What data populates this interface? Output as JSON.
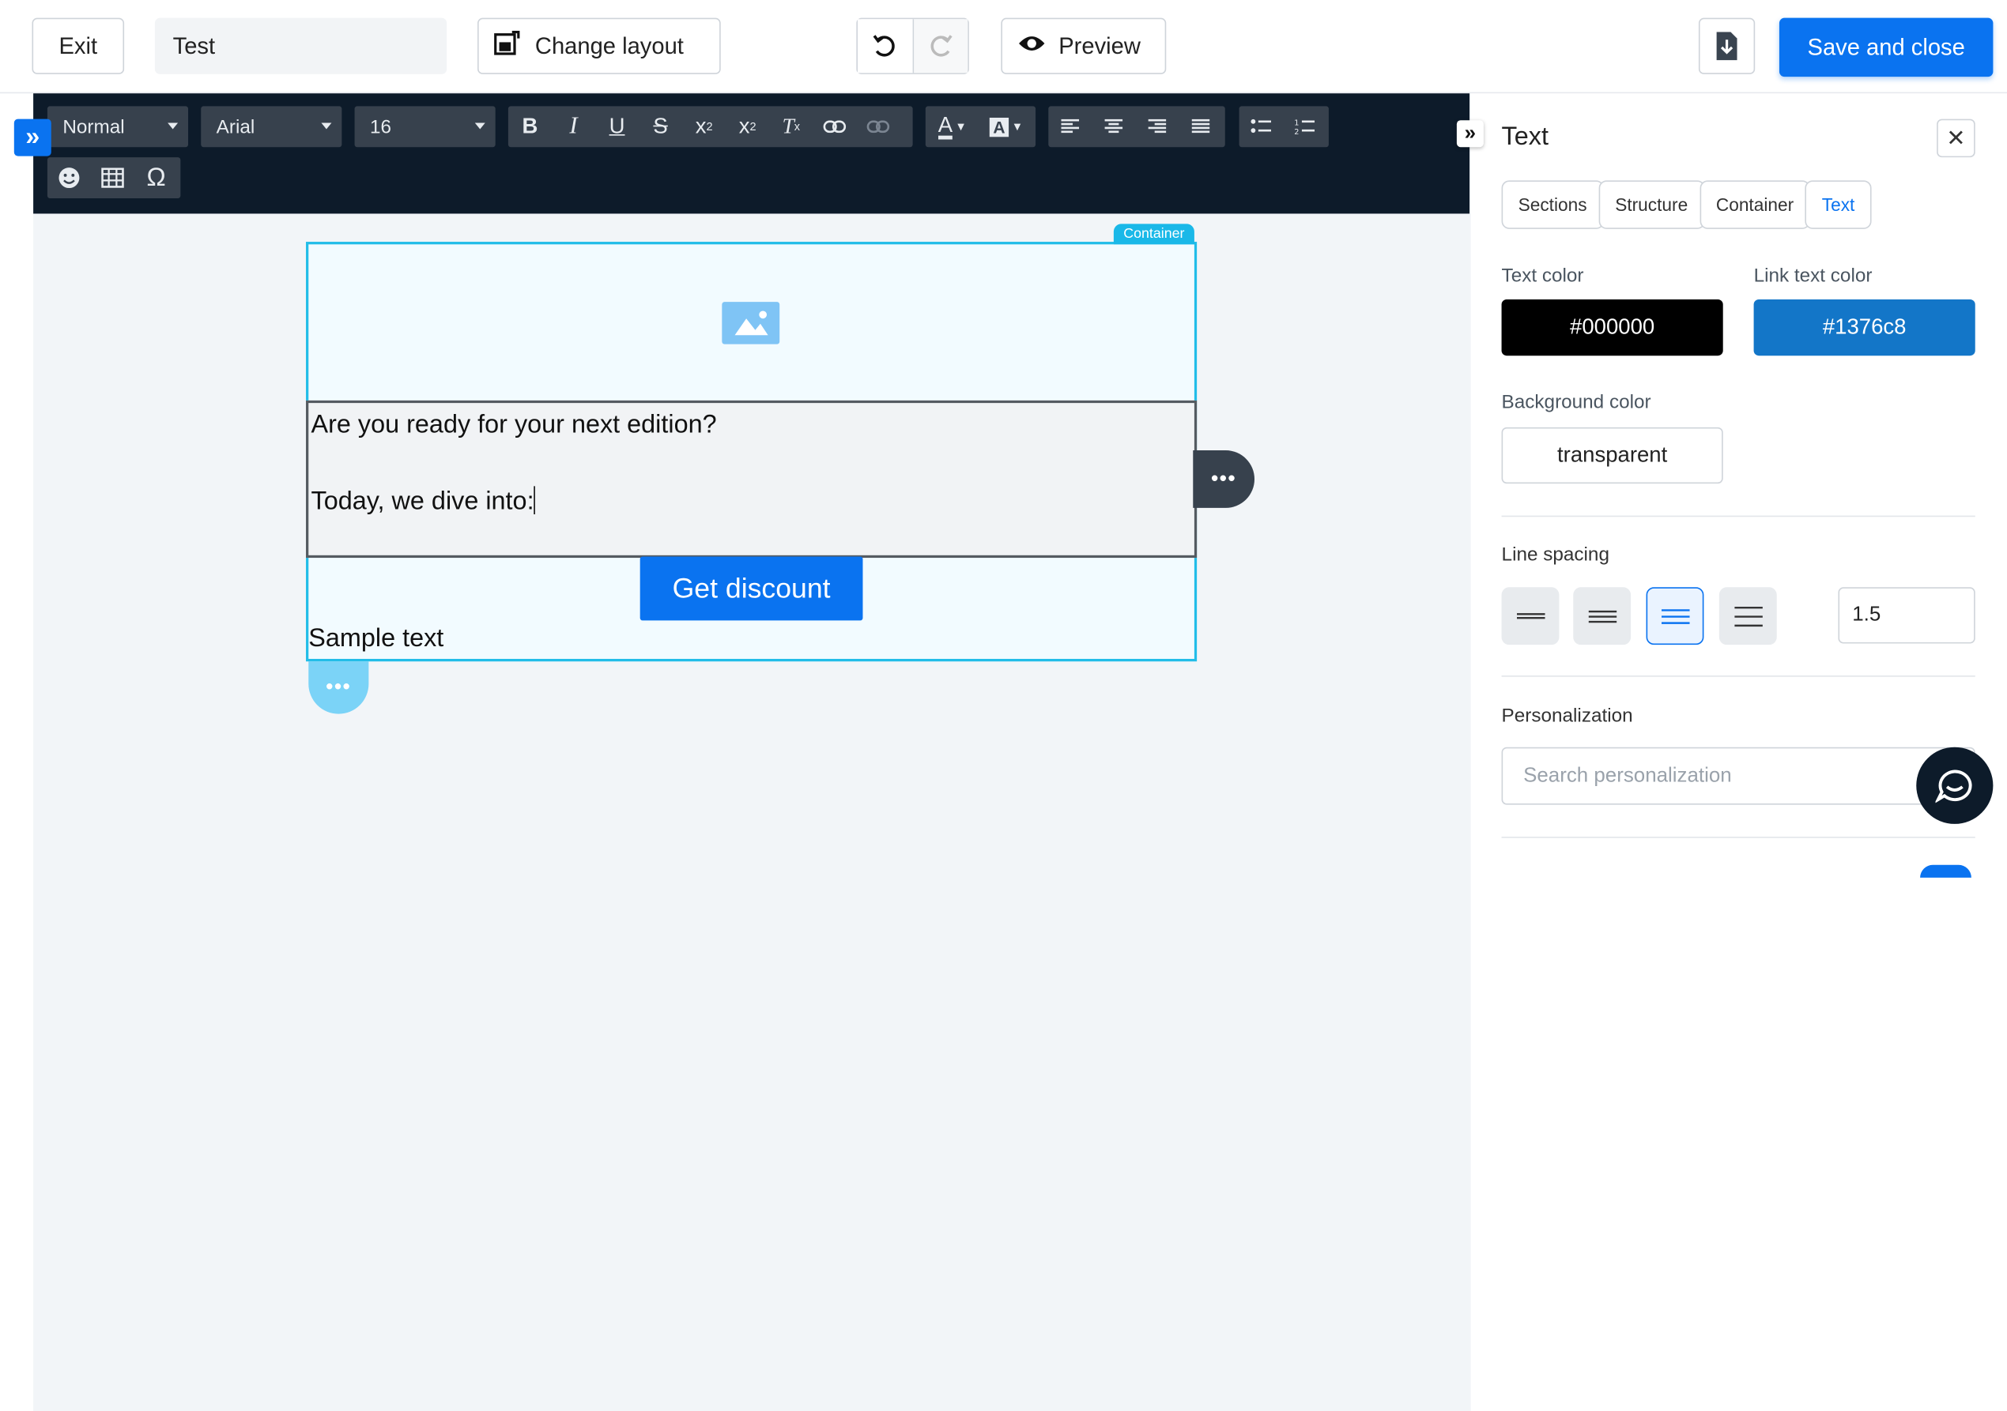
{
  "topbar": {
    "exit_label": "Exit",
    "title_value": "Test",
    "change_layout_label": "Change layout",
    "preview_label": "Preview",
    "save_label": "Save and close"
  },
  "toolbar": {
    "format_value": "Normal",
    "font_value": "Arial",
    "size_value": "16",
    "icons": [
      "bold-icon",
      "italic-icon",
      "underline-icon",
      "strikethrough-icon",
      "subscript-icon",
      "superscript-icon",
      "clear-format-icon",
      "link-icon",
      "unlink-icon",
      "text-color-icon",
      "background-color-icon",
      "align-left-icon",
      "align-center-icon",
      "align-right-icon",
      "align-justify-icon",
      "bullet-list-icon",
      "numbered-list-icon",
      "emoji-icon",
      "table-icon",
      "special-char-icon"
    ]
  },
  "canvas": {
    "container_tag": "Container",
    "text_line1": "Are you ready for your next edition?",
    "text_line2": "Today, we dive into:",
    "button_label": "Get discount",
    "sample_text": "Sample text",
    "more_label": "•••"
  },
  "panel": {
    "title": "Text",
    "breadcrumbs": [
      "Sections",
      "Structure",
      "Container",
      "Text"
    ],
    "text_color_label": "Text color",
    "text_color_value": "#000000",
    "link_color_label": "Link text color",
    "link_color_value": "#1376c8",
    "bg_color_label": "Background color",
    "bg_color_value": "transparent",
    "line_spacing_label": "Line spacing",
    "line_spacing_value": "1.5",
    "personalization_label": "Personalization",
    "personalization_placeholder": "Search personalization"
  },
  "colors": {
    "accent": "#0a73f0",
    "toolbar_bg": "#0d1b2a",
    "container_border": "#22bde8",
    "link_color": "#1376c8"
  }
}
